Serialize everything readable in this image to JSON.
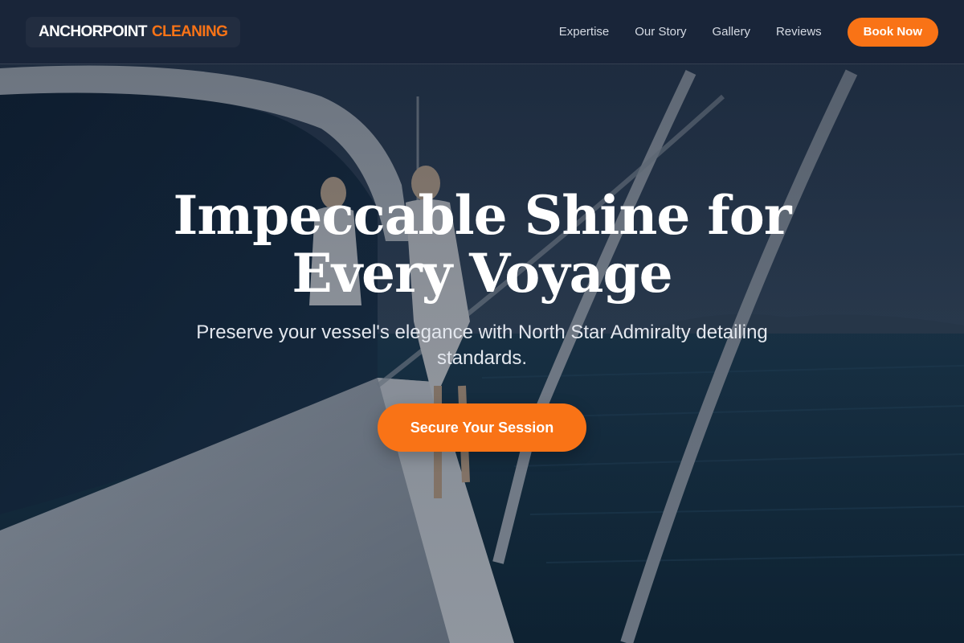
{
  "header": {
    "logo": {
      "main": "ANCHORPOINT",
      "accent": "CLEANING"
    },
    "nav": [
      {
        "label": "Expertise"
      },
      {
        "label": "Our Story"
      },
      {
        "label": "Gallery"
      },
      {
        "label": "Reviews"
      }
    ],
    "cta_label": "Book Now"
  },
  "hero": {
    "title": "Impeccable Shine for Every Voyage",
    "subtitle": "Preserve your vessel's elegance with North Star Admiralty detailing standards.",
    "cta_label": "Secure Your Session",
    "background_image": "yacht-deck-ocean-photo"
  },
  "colors": {
    "accent": "#f97316",
    "header_bg": "#1a2538",
    "text_light": "#ffffff"
  }
}
